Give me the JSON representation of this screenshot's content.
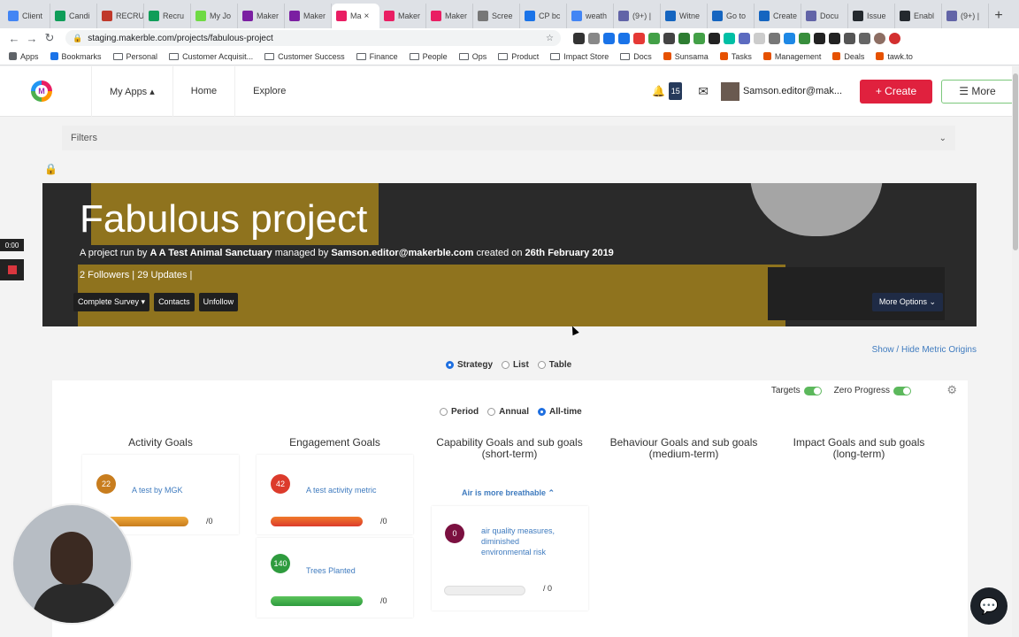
{
  "browser": {
    "tabs": [
      {
        "label": "Client",
        "color": "#4285f4"
      },
      {
        "label": "Candi",
        "color": "#0f9d58"
      },
      {
        "label": "RECRU",
        "color": "#c0392b"
      },
      {
        "label": "Recru",
        "color": "#0f9d58"
      },
      {
        "label": "My Jo",
        "color": "#6fda44"
      },
      {
        "label": "Maker",
        "color": "#7b1fa2"
      },
      {
        "label": "Maker",
        "color": "#7b1fa2"
      },
      {
        "label": "Ma",
        "color": "#e91e63",
        "active": true
      },
      {
        "label": "Maker",
        "color": "#e91e63"
      },
      {
        "label": "Maker",
        "color": "#e91e63"
      },
      {
        "label": "Scree",
        "color": "#777777"
      },
      {
        "label": "CP bc",
        "color": "#1a73e8"
      },
      {
        "label": "weath",
        "color": "#4285f4"
      },
      {
        "label": "(9+) |",
        "color": "#6264a7"
      },
      {
        "label": "Witne",
        "color": "#1565c0"
      },
      {
        "label": "Go to",
        "color": "#1565c0"
      },
      {
        "label": "Create",
        "color": "#1565c0"
      },
      {
        "label": "Docu",
        "color": "#6264a7"
      },
      {
        "label": "Issue",
        "color": "#24292e"
      },
      {
        "label": "Enabl",
        "color": "#24292e"
      },
      {
        "label": "(9+) |",
        "color": "#6264a7"
      }
    ],
    "url": "staging.makerble.com/projects/fabulous-project",
    "bookmarks": [
      {
        "label": "Apps",
        "kind": "grid"
      },
      {
        "label": "Bookmarks",
        "kind": "star"
      },
      {
        "label": "Personal",
        "kind": "folder"
      },
      {
        "label": "Customer Acquisit...",
        "kind": "folder"
      },
      {
        "label": "Customer Success",
        "kind": "folder"
      },
      {
        "label": "Finance",
        "kind": "folder"
      },
      {
        "label": "People",
        "kind": "folder"
      },
      {
        "label": "Ops",
        "kind": "folder"
      },
      {
        "label": "Product",
        "kind": "folder"
      },
      {
        "label": "Impact Store",
        "kind": "folder"
      },
      {
        "label": "Docs",
        "kind": "folder"
      },
      {
        "label": "Sunsama",
        "kind": "app"
      },
      {
        "label": "Tasks",
        "kind": "app"
      },
      {
        "label": "Management",
        "kind": "app"
      },
      {
        "label": "Deals",
        "kind": "app"
      },
      {
        "label": "tawk.to",
        "kind": "app"
      }
    ]
  },
  "header": {
    "logo_letter": "M",
    "nav": [
      "My Apps ▴",
      "Home",
      "Explore"
    ],
    "notifications": "15",
    "username": "Samson.editor@mak...",
    "create_label": "+ Create",
    "more_label": "☰ More"
  },
  "filters": {
    "label": "Filters"
  },
  "project": {
    "title": "Fabulous project",
    "meta_prefix": "A project run by ",
    "org": "A A Test Animal Sanctuary",
    "meta_mid": " managed by ",
    "manager": "Samson.editor@makerble.com",
    "meta_mid2": " created on ",
    "created": "26th February 2019",
    "stats": "2 Followers | 29 Updates |",
    "buttons": [
      "Complete Survey ▾",
      "Contacts",
      "Unfollow"
    ],
    "more_options": "More Options ⌄"
  },
  "recording": {
    "timer": "0:00"
  },
  "view": {
    "metric_origins": "Show / Hide Metric Origins",
    "modes": [
      {
        "label": "Strategy",
        "selected": true
      },
      {
        "label": "List",
        "selected": false
      },
      {
        "label": "Table",
        "selected": false
      }
    ],
    "periods": [
      {
        "label": "Period",
        "selected": false
      },
      {
        "label": "Annual",
        "selected": false
      },
      {
        "label": "All-time",
        "selected": true
      }
    ],
    "toggles": [
      "Targets",
      "Zero Progress"
    ]
  },
  "columns": [
    {
      "title": "Activity Goals"
    },
    {
      "title": "Engagement Goals"
    },
    {
      "title": "Capability Goals and sub goals (short-term)"
    },
    {
      "title": "Behaviour Goals and sub goals (medium-term)"
    },
    {
      "title": "Impact Goals and sub goals (long-term)"
    }
  ],
  "metrics": {
    "activity": [
      {
        "value": "22",
        "label": "A test by MGK",
        "target": "/0",
        "color": "#c87d1e"
      }
    ],
    "engagement": [
      {
        "value": "42",
        "label": "A test activity metric",
        "target": "/0",
        "color": "#dc3b2c"
      },
      {
        "value": "140",
        "label": "Trees Planted",
        "target": "/0",
        "color": "#2e9b3e"
      }
    ],
    "capability_subgoal": "Air is more breathable ⌃",
    "capability": [
      {
        "value": "0",
        "label": "air quality measures, diminished environmental risk",
        "target": "/ 0",
        "color": "#7b1040"
      }
    ]
  }
}
